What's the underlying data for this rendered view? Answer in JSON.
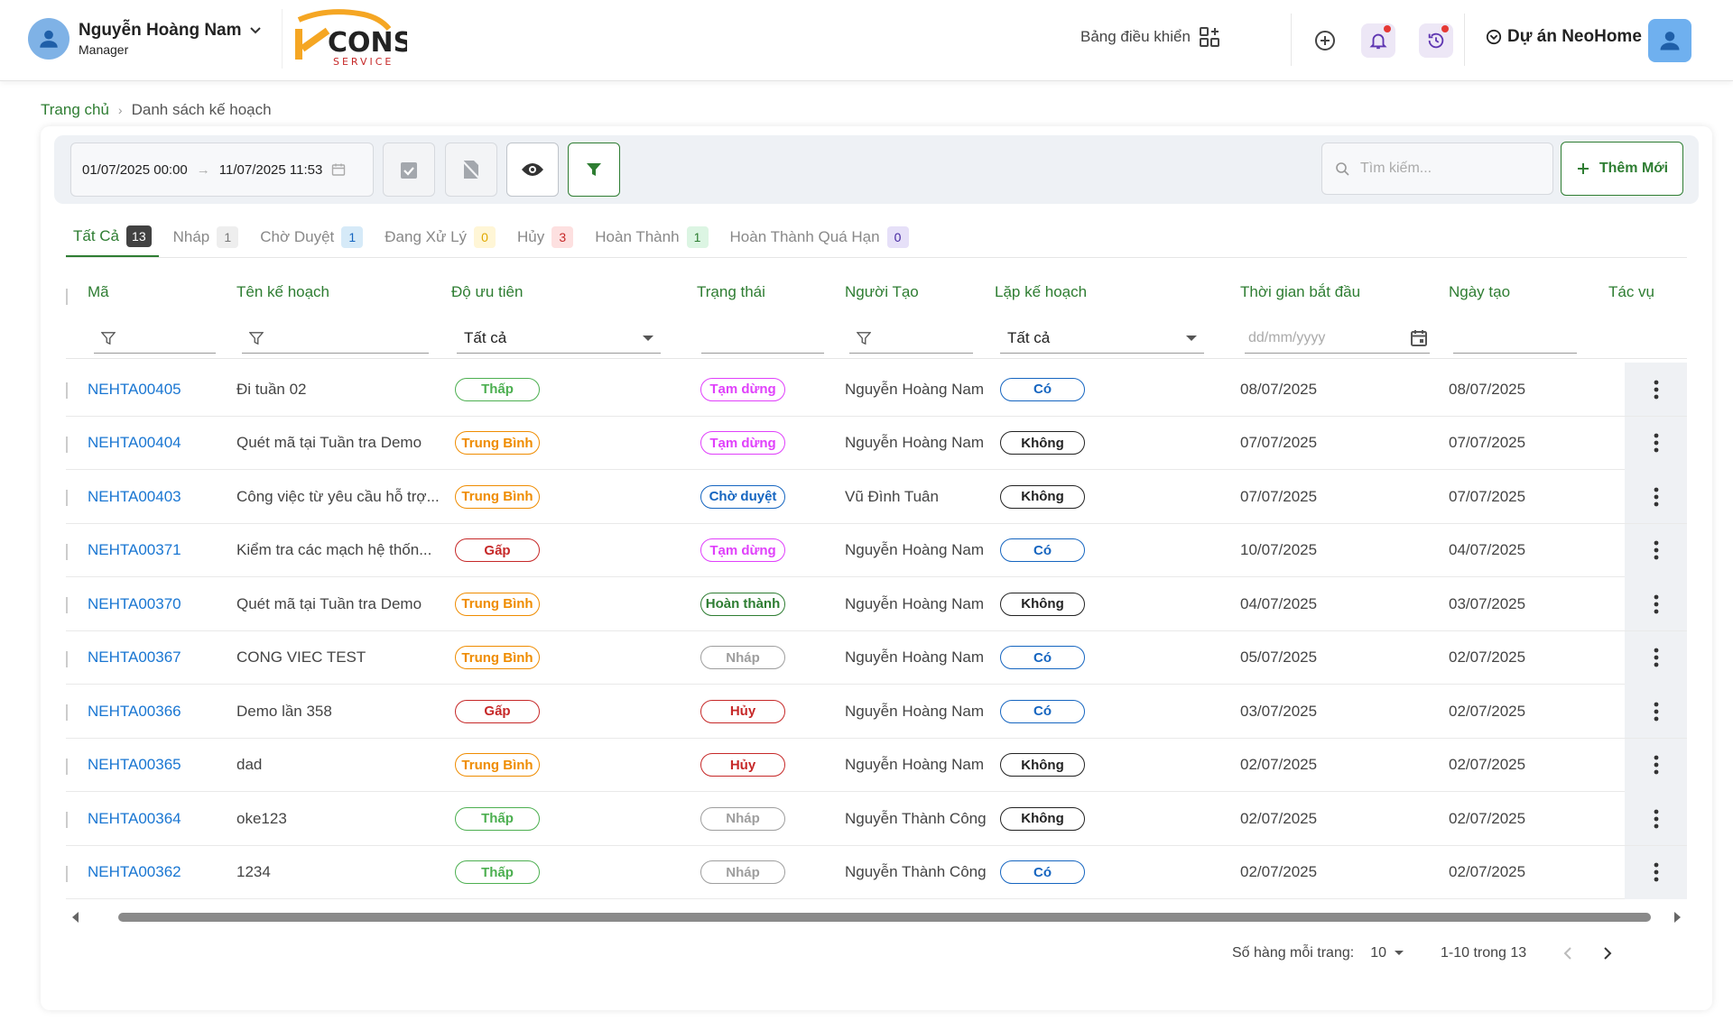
{
  "header": {
    "user_name": "Nguyễn Hoàng Nam",
    "user_role": "Manager",
    "dashboard_label": "Bảng điều khiển",
    "project_label": "Dự án NeoHome",
    "logo_text": "CONS SERVICE"
  },
  "breadcrumb": {
    "home": "Trang chủ",
    "current": "Danh sách kế hoạch"
  },
  "toolbar": {
    "date_from": "01/07/2025 00:00",
    "date_to": "11/07/2025 11:53",
    "search_placeholder": "Tìm kiếm...",
    "add_label": "Thêm Mới"
  },
  "tabs": [
    {
      "label": "Tất Cả",
      "count": "13",
      "bg": "#424242",
      "fg": "#ffffff"
    },
    {
      "label": "Nháp",
      "count": "1",
      "bg": "#eeeeee",
      "fg": "#777777"
    },
    {
      "label": "Chờ Duyệt",
      "count": "1",
      "bg": "#d6eaf8",
      "fg": "#1565c0"
    },
    {
      "label": "Đang Xử Lý",
      "count": "0",
      "bg": "#fff6d6",
      "fg": "#e0a800"
    },
    {
      "label": "Hủy",
      "count": "3",
      "bg": "#fde0e0",
      "fg": "#c62828"
    },
    {
      "label": "Hoàn Thành",
      "count": "1",
      "bg": "#dcf5e3",
      "fg": "#2e7d32"
    },
    {
      "label": "Hoàn Thành Quá Hạn",
      "count": "0",
      "bg": "#e6e0f8",
      "fg": "#4527a0"
    }
  ],
  "columns": {
    "code": "Mã",
    "name": "Tên kế hoạch",
    "priority": "Độ ưu tiên",
    "status": "Trạng thái",
    "creator": "Người Tạo",
    "recurring": "Lặp kế hoạch",
    "start": "Thời gian bắt đầu",
    "created": "Ngày tạo",
    "actions": "Tác vụ"
  },
  "filters": {
    "priority_value": "Tất cả",
    "recurring_value": "Tất cả",
    "date_placeholder": "dd/mm/yyyy"
  },
  "pill_styles": {
    "Thấp": "#4caf50",
    "Trung Bình": "#ef8c00",
    "Gấp": "#c62828",
    "Tạm dừng": "#e040fb",
    "Chờ duyệt": "#1565c0",
    "Hoàn thành": "#2e7d32",
    "Nháp": "#9e9e9e",
    "Hủy": "#c62828",
    "Có": "#1565c0",
    "Không": "#222222"
  },
  "rows": [
    {
      "code": "NEHTA00405",
      "name": "Đi tuần 02",
      "priority": "Thấp",
      "status": "Tạm dừng",
      "creator": "Nguyễn Hoàng Nam",
      "recurring": "Có",
      "start": "08/07/2025",
      "created": "08/07/2025"
    },
    {
      "code": "NEHTA00404",
      "name": "Quét mã tại Tuần tra Demo",
      "priority": "Trung Bình",
      "status": "Tạm dừng",
      "creator": "Nguyễn Hoàng Nam",
      "recurring": "Không",
      "start": "07/07/2025",
      "created": "07/07/2025"
    },
    {
      "code": "NEHTA00403",
      "name": "Công việc từ yêu cầu hỗ trợ...",
      "priority": "Trung Bình",
      "status": "Chờ duyệt",
      "creator": "Vũ Đình Tuân",
      "recurring": "Không",
      "start": "07/07/2025",
      "created": "07/07/2025"
    },
    {
      "code": "NEHTA00371",
      "name": "Kiểm tra các mạch hệ thốn...",
      "priority": "Gấp",
      "status": "Tạm dừng",
      "creator": "Nguyễn Hoàng Nam",
      "recurring": "Có",
      "start": "10/07/2025",
      "created": "04/07/2025"
    },
    {
      "code": "NEHTA00370",
      "name": "Quét mã tại Tuần tra Demo",
      "priority": "Trung Bình",
      "status": "Hoàn thành",
      "creator": "Nguyễn Hoàng Nam",
      "recurring": "Không",
      "start": "04/07/2025",
      "created": "03/07/2025"
    },
    {
      "code": "NEHTA00367",
      "name": "CONG VIEC TEST",
      "priority": "Trung Bình",
      "status": "Nháp",
      "creator": "Nguyễn Hoàng Nam",
      "recurring": "Có",
      "start": "05/07/2025",
      "created": "02/07/2025"
    },
    {
      "code": "NEHTA00366",
      "name": "Demo lần 358",
      "priority": "Gấp",
      "status": "Hủy",
      "creator": "Nguyễn Hoàng Nam",
      "recurring": "Có",
      "start": "03/07/2025",
      "created": "02/07/2025"
    },
    {
      "code": "NEHTA00365",
      "name": "dad",
      "priority": "Trung Bình",
      "status": "Hủy",
      "creator": "Nguyễn Hoàng Nam",
      "recurring": "Không",
      "start": "02/07/2025",
      "created": "02/07/2025"
    },
    {
      "code": "NEHTA00364",
      "name": "oke123",
      "priority": "Thấp",
      "status": "Nháp",
      "creator": "Nguyễn Thành Công",
      "recurring": "Không",
      "start": "02/07/2025",
      "created": "02/07/2025"
    },
    {
      "code": "NEHTA00362",
      "name": "1234",
      "priority": "Thấp",
      "status": "Nháp",
      "creator": "Nguyễn Thành Công",
      "recurring": "Có",
      "start": "02/07/2025",
      "created": "02/07/2025"
    }
  ],
  "pagination": {
    "rows_per_page_label": "Số hàng mỗi trang:",
    "rows_per_page": "10",
    "range": "1-10 trong 13"
  }
}
